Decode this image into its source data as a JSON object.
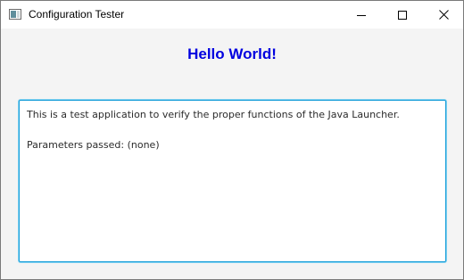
{
  "window": {
    "title": "Configuration Tester",
    "icon": "app-window-icon",
    "controls": {
      "minimize": "minimize-icon",
      "maximize": "maximize-icon",
      "close": "close-icon"
    }
  },
  "main": {
    "heading": "Hello World!",
    "heading_color": "#0000e0",
    "output": {
      "line1": "This is a test application to verify the proper functions of the Java Launcher.",
      "line2": "",
      "line3": "Parameters passed: (none)"
    }
  },
  "colors": {
    "accent_border": "#1a9fd9"
  }
}
